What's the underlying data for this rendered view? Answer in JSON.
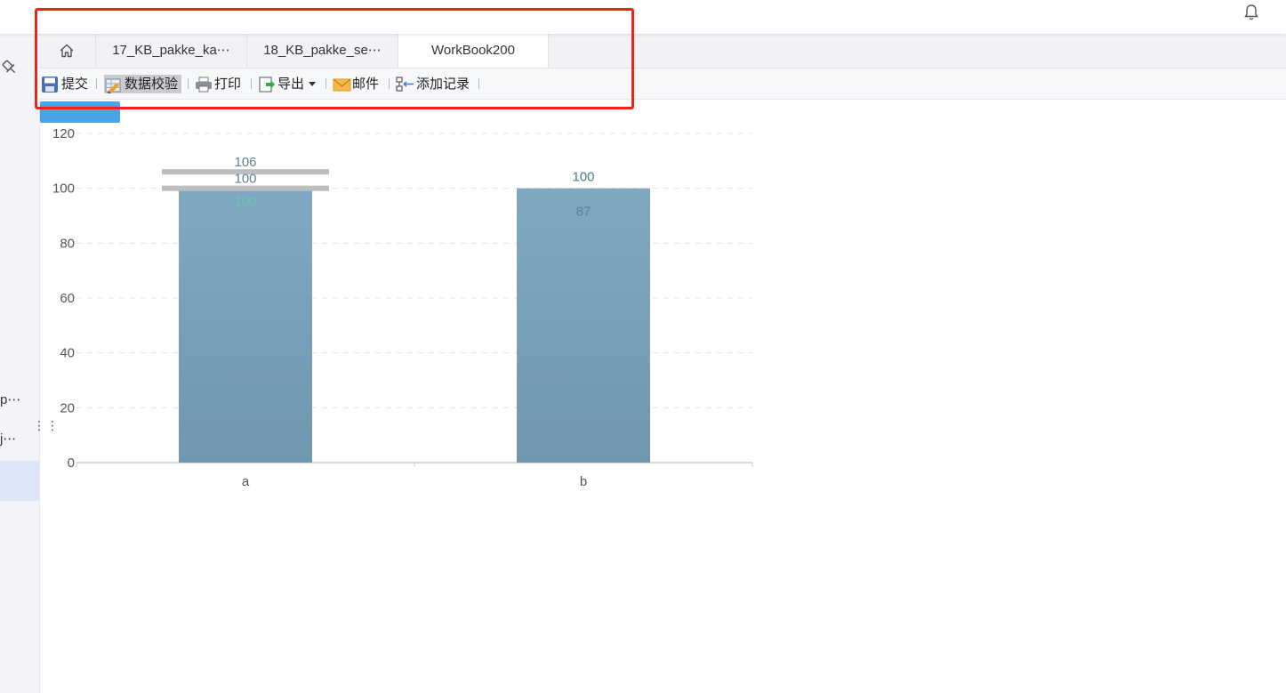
{
  "tabs": {
    "home_icon": "home-icon",
    "items": [
      {
        "label": "17_KB_pakke_ka⋯",
        "active": false
      },
      {
        "label": "18_KB_pakke_se⋯",
        "active": false
      },
      {
        "label": "WorkBook200",
        "active": true
      }
    ]
  },
  "toolbar": {
    "submit": {
      "label": "提交",
      "icon": "save-icon"
    },
    "validate": {
      "label": "数据校验",
      "icon": "pencil-grid-icon"
    },
    "print": {
      "label": "打印",
      "icon": "printer-icon"
    },
    "export": {
      "label": "导出",
      "icon": "export-icon",
      "dropdown": "chevron-down-icon"
    },
    "mail": {
      "label": "邮件",
      "icon": "envelope-icon"
    },
    "add_record": {
      "label": "添加记录",
      "icon": "add-record-icon"
    }
  },
  "left_panel": {
    "items": [
      "p⋯",
      "j⋯"
    ]
  },
  "colors": {
    "bar": "#7fa8c2",
    "highlight": "#e8261e",
    "button": "#4aa3e8",
    "label_teal": "#6cc4b4",
    "label_slate": "#5e7f9a"
  },
  "chart_data": {
    "type": "bar",
    "categories": [
      "a",
      "b"
    ],
    "values": [
      100,
      100
    ],
    "ylim": [
      0,
      120
    ],
    "yticks": [
      0,
      20,
      40,
      60,
      80,
      100,
      120
    ],
    "grid": true,
    "reference_lines": [
      {
        "category": "a",
        "value": 106
      },
      {
        "category": "a",
        "value": 100
      }
    ],
    "labels": [
      {
        "category": "a",
        "text": "106",
        "value": 106,
        "color": "#5e7f9a"
      },
      {
        "category": "a",
        "text": "100",
        "value": 100,
        "color": "#5e7f9a"
      },
      {
        "category": "a",
        "text": "100",
        "value": 100,
        "color": "#6cc4b4"
      },
      {
        "category": "b",
        "text": "100",
        "value": 100,
        "color": "#6cc4b4"
      },
      {
        "category": "b",
        "text": "100",
        "value": 100,
        "color": "#5e7f9a"
      },
      {
        "category": "b",
        "text": "87",
        "value": 87,
        "color": "#5e7f9a"
      }
    ]
  }
}
